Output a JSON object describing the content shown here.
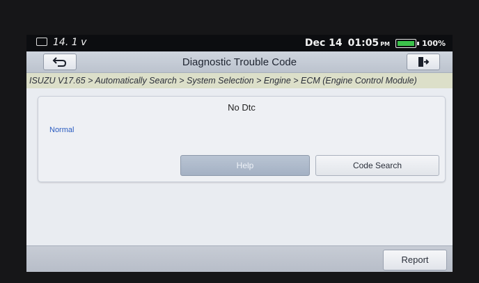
{
  "status_bar": {
    "voltage": "14. 1 v",
    "date": "Dec 14",
    "time": "01:05",
    "ampm": "PM",
    "battery_percent": "100%",
    "battery_color": "#3cc24b"
  },
  "header": {
    "title": "Diagnostic Trouble Code",
    "back_icon": "back-arrow-icon",
    "exit_icon": "exit-door-icon"
  },
  "breadcrumb": "ISUZU V17.65 > Automatically Search > System Selection > Engine > ECM (Engine Control Module)",
  "dtc_panel": {
    "title": "No Dtc",
    "status": "Normal",
    "help_label": "Help",
    "code_search_label": "Code Search"
  },
  "footer": {
    "report_label": "Report"
  }
}
